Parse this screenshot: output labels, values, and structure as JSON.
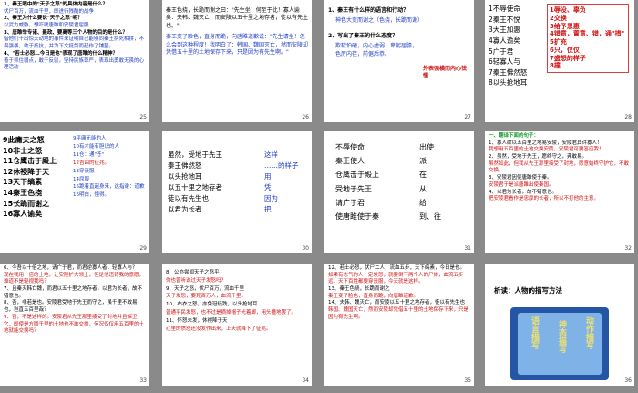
{
  "slides": [
    {
      "num": "25",
      "lines": [
        "1、秦王眼中的\"天子之怒\"的具体内容是什么？",
        "伏尸百万，流血千里，即进行残酷的战争",
        "2、秦王为什么要说\"天子之怒\"呢？",
        "以武力威胁，想吓唬唐雎和安陵君屈服",
        "3、唐雎举专诸、聂政、要离等三个人物的目的是什么？",
        "借他们干出惊天动地的事件来证明自己能够同秦王拼死相拼，不畏强暴，敢于抵抗，并为下文挺剑而起作了铺垫。",
        "4、\"若士必怒…今日是也\"表现了唐雎的什么精神？",
        "善于抓住弱点，敢于反驳，坚持民族尊严，表现出勇敢无畏的心理活动"
      ]
    },
    {
      "num": "26",
      "p1": "秦王色挠，长跪而谢之曰：\"先生坐！何至于此！寡人谕矣：夫韩、魏灭亡，而安陵以五十里之地存者，徒以有先生也。\"",
      "p2": "秦王变了脸色，直身而跪，向唐雎道歉说：\"先生请坐！怎么会到这种程度！我明白了：韩国、魏国灭亡，然而安陵却凭借五十里的土地保存下来，只是因为有先生啊。\""
    },
    {
      "num": "27",
      "q1": "1、秦王有什么样的语言和行动？",
      "a1": "神色大变而谢之（色挠，长跪而谢）",
      "q2": "2、写出了秦王的什么态度？",
      "a2": "欺软怕硬，内心虚弱，卑躬屈膝，色厉内荏，前倨后恭。",
      "note": "外表强横而内心怯懦"
    },
    {
      "num": "28",
      "items": [
        "1不辱使命",
        "2秦王不悦",
        "3大王加惠",
        "4寡人谕矣",
        "5广于君",
        "6轻寡人与",
        "7秦王怫然怒",
        "8以头抢地耳"
      ],
      "box": [
        "1辱没、辜负",
        "2交换",
        "3给予恩惠",
        "4错意，置意、错，通\"措\"",
        "5扩充",
        "6只，仅仅",
        "7盛怒的样子",
        "8撞"
      ]
    },
    {
      "num": "29",
      "left": [
        "9此庸夫之怒",
        "10非士之怒",
        "11仓鹰击于殿上",
        "12休祲降于天",
        "13天下缟素",
        "14秦王色挠",
        "15长跪而谢之",
        "16寡人谕矣"
      ],
      "right": [
        "9平庸无能的人",
        "10有才能有胆识的人",
        "11仓：通\"苍\"",
        "12吉凶的征兆。",
        "13穿丧服",
        "14屈服",
        "15跪着直起身来，这指谢：道歉",
        "16明白，懂得。"
      ],
      "mid": [
        "(整个词语和单个词)",
        "(单个词）"
      ]
    },
    {
      "num": "30",
      "left": [
        "虽然，受地于先王",
        "秦王佛然怒",
        "以头抢地耳",
        "以五十里之地存者",
        "徒以有先生也",
        "以君为长者"
      ],
      "right": [
        "这样",
        "……的样子",
        "用",
        "凭",
        "因为",
        "把"
      ]
    },
    {
      "num": "31",
      "left": [
        "不辱使命",
        "秦王使人",
        "仓鹰击于殿上",
        "受地于先王",
        "请广于君",
        "使唐雎使于秦"
      ],
      "right": [
        "出使",
        "派",
        "在",
        "从",
        "给",
        "到、往"
      ]
    },
    {
      "num": "32",
      "title": "一、翻译下面的句子：",
      "lines": [
        "1、寡人欲以五百里之地易安陵，安陵君其许寡人！",
        "我想用五百里的土地交换安陵，安陵君可要答应我！",
        "2、虽然，受地于先王，愿终守之，弗敢易。",
        "虽然如此，但我从先王那里接受了封地，愿意始终守护它，不敢交换。",
        "3、安陵君因使唐雎使于秦。",
        "安陵君于是派唐雎出使秦国。",
        "4、以君为长者，故不错意也。",
        "把安陵君看作是忠厚的长者，所以不打他的主意。"
      ]
    },
    {
      "num": "33",
      "lines": [
        "6、今吾以十倍之地，请广于君，而君逆寡人者，轻寡人与？",
        "现在我用十倍的土地，让安陵扩大领土，但是他违背我的意愿，难道不是轻视我吗？",
        "7、且秦灭韩亡魏，而君以五十里之地存者，以君为长者，故不错意也。",
        "8、否，非若是也。安陵君受地于先王而守之，虽千里不敢易也，岂直五百里哉？",
        "9、否，不是这样的。安陵君从先王那里接受了封地并且保卫它，即使是方圆千里的土地也不敢交换，何况仅仅用五百里的土地就能交换吗？"
      ]
    },
    {
      "num": "34",
      "lines": [
        "8、公亦尝闻天子之怒乎",
        "你也曾听说过天子发怒吗？",
        "9、天子之怒，伏尸百万，流血千里",
        "天子发怒，要死百万人，血流千里。",
        "10、布衣之怒，亦免冠徒跣，以头抢地耳",
        "普通平民发怒，也不过是摘掉帽子光着脚，用头撞地罢了。",
        "11、怀怒未发，休祲降于天",
        "心里的愤怒还没发作出来，上天就降下了征兆。"
      ]
    },
    {
      "num": "35",
      "lines": [
        "12、若士必怒，伏尸二人，流血五步，天下缟素，今日是也。",
        "如果有志气的人一定发怒，就要倒下两个人的尸体，血流五步远，天下百姓都要穿丧服，今天就是这样。",
        "13、秦王色挠，长跪而谢之",
        "秦王变了脸色，直身而跪，向唐雎道歉。",
        "14、夫韩、魏灭亡，而安陵以五十里之地存者，徒以有先生也",
        "韩国、魏国灭亡，然而安陵却凭借五十里的土地保存下来，只是因为有先生啊。"
      ]
    },
    {
      "num": "36",
      "title": "析读：人物的描写方法",
      "scroll": [
        "动作描写",
        "神态描写",
        "语言描写"
      ]
    }
  ]
}
